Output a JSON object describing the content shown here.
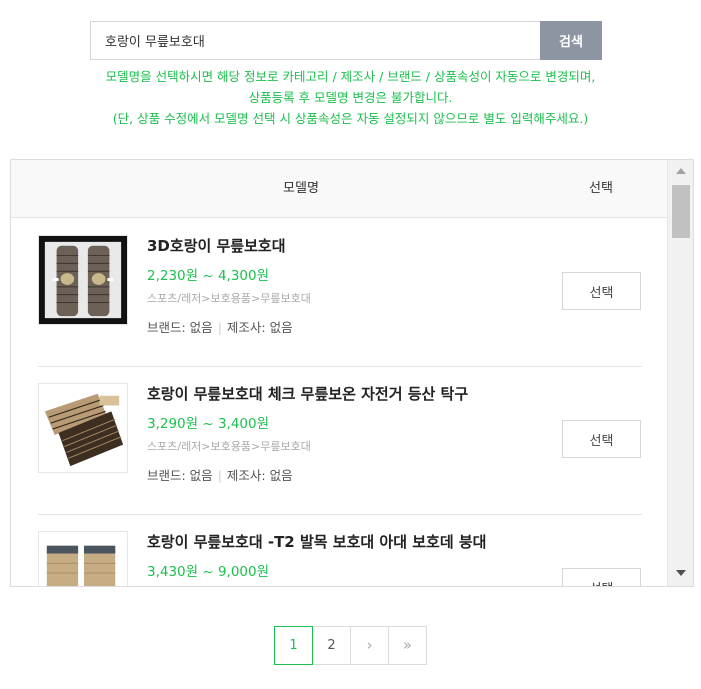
{
  "search": {
    "value": "호랑이 무릎보호대",
    "button_label": "검색"
  },
  "notice": {
    "line1": "모델명을 선택하시면 해당 정보로 카테고리 / 제조사 / 브랜드 / 상품속성이 자동으로 변경되며,",
    "line2": "상품등록 후 모델명 변경은 불가합니다.",
    "line3": "(단, 상품 수정에서 모델명 선택 시 상품속성은 자동 설정되지 않으므로 별도 입력해주세요.)"
  },
  "table": {
    "col_model": "모델명",
    "col_select": "선택"
  },
  "products": [
    {
      "name": "3D호랑이 무릎보호대",
      "price": "2,230원 ~ 4,300원",
      "category": "스포츠/레저>보호용품>무릎보호대",
      "brand": "브랜드: 없음",
      "maker": "제조사: 없음",
      "select_label": "선택"
    },
    {
      "name": "호랑이 무릎보호대 체크 무릎보온 자전거 등산 탁구",
      "price": "3,290원 ~ 3,400원",
      "category": "스포츠/레저>보호용품>무릎보호대",
      "brand": "브랜드: 없음",
      "maker": "제조사: 없음",
      "select_label": "선택"
    },
    {
      "name": "호랑이 무릎보호대 -T2 발목 보호대 아대 보호데 붕대",
      "price": "3,430원 ~ 9,000원",
      "category": "",
      "brand": "",
      "maker": "",
      "select_label": "선택"
    }
  ],
  "pagination": {
    "pages": [
      "1",
      "2"
    ],
    "next": "›",
    "last": "»"
  },
  "colors": {
    "accent_green": "#1dbf4e",
    "search_button": "#8d95a3"
  }
}
